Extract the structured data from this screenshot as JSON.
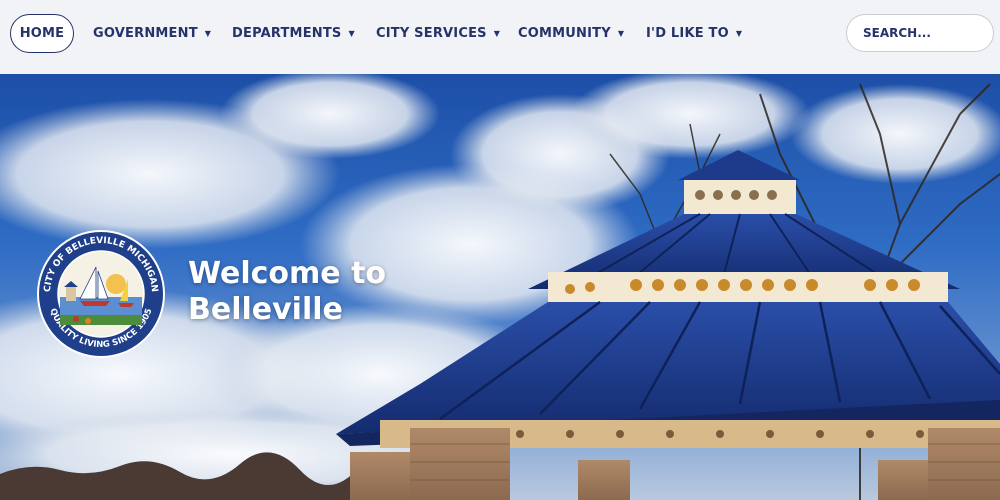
{
  "nav": {
    "home": "HOME",
    "items": [
      {
        "label": "GOVERNMENT"
      },
      {
        "label": "DEPARTMENTS"
      },
      {
        "label": "CITY SERVICES"
      },
      {
        "label": "COMMUNITY"
      },
      {
        "label": "I'D LIKE TO"
      }
    ],
    "dropdown_icon": "caret-down-icon"
  },
  "search": {
    "placeholder": "SEARCH..."
  },
  "hero": {
    "title_line1": "Welcome to",
    "title_line2": "Belleville",
    "seal": {
      "top_text": "CITY OF BELLEVILLE MICHIGAN",
      "bottom_text": "QUALITY LIVING SINCE 1905"
    }
  },
  "colors": {
    "brand": "#26336a",
    "nav_bg": "#f1f3f6",
    "sky": "#1d4fa7",
    "gazebo_roof": "#1e3a8a"
  }
}
